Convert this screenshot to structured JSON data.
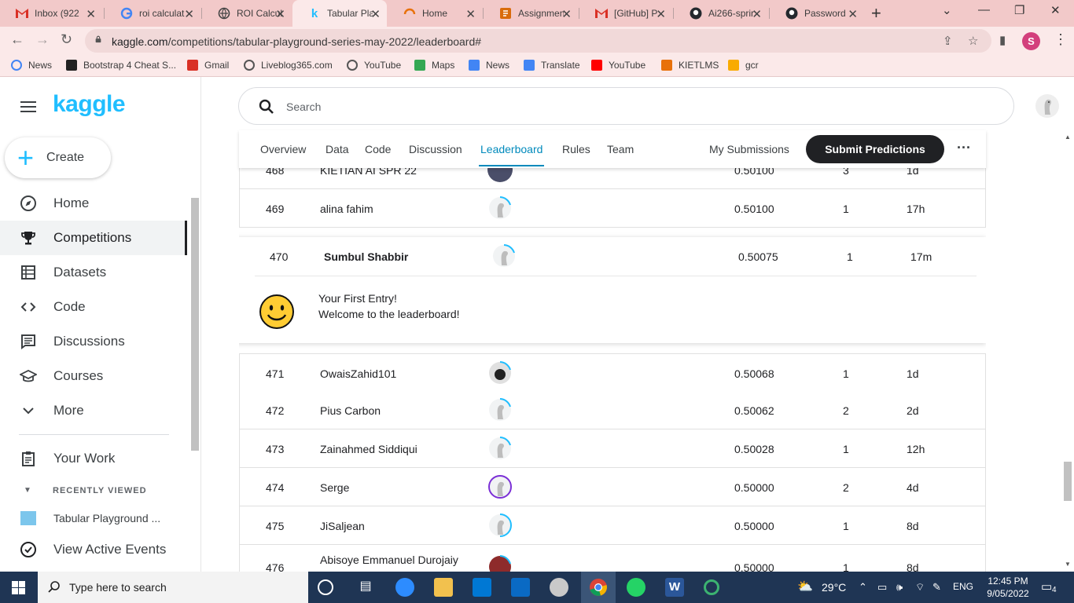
{
  "browser": {
    "tabs": [
      {
        "label": "Inbox (922",
        "icon": "gmail-icon"
      },
      {
        "label": "roi calculat",
        "icon": "google-icon"
      },
      {
        "label": "ROI Calcul",
        "icon": "globe-icon"
      },
      {
        "label": "Tabular Pla",
        "icon": "kaggle-icon",
        "active": true
      },
      {
        "label": "Home",
        "icon": "home-icon"
      },
      {
        "label": "Assignmen",
        "icon": "assignment-icon"
      },
      {
        "label": "[GitHub] P",
        "icon": "gmail-icon"
      },
      {
        "label": "Ai266-sprir",
        "icon": "github-icon"
      },
      {
        "label": "Password",
        "icon": "github-icon"
      }
    ],
    "url_host": "kaggle.com",
    "url_path": "/competitions/tabular-playground-series-may-2022/leaderboard#",
    "profile_initial": "S",
    "bookmarks": [
      "News",
      "Bootstrap 4 Cheat S...",
      "Gmail",
      "Liveblog365.com",
      "YouTube",
      "Maps",
      "News",
      "Translate",
      "YouTube",
      "KIETLMS",
      "gcr"
    ]
  },
  "sidebar": {
    "logo": "kaggle",
    "create_label": "Create",
    "items": [
      {
        "label": "Home",
        "icon": "compass-icon"
      },
      {
        "label": "Competitions",
        "icon": "trophy-icon",
        "active": true
      },
      {
        "label": "Datasets",
        "icon": "table-icon"
      },
      {
        "label": "Code",
        "icon": "code-icon"
      },
      {
        "label": "Discussions",
        "icon": "comments-icon"
      },
      {
        "label": "Courses",
        "icon": "graduation-cap-icon"
      },
      {
        "label": "More",
        "icon": "chevron-down-icon"
      }
    ],
    "your_work": "Your Work",
    "recently_viewed_header": "RECENTLY VIEWED",
    "recent_item": "Tabular Playground ...",
    "view_active_events": "View Active Events"
  },
  "search": {
    "placeholder": "Search"
  },
  "competition_tabs": {
    "items": [
      "Overview",
      "Data",
      "Code",
      "Discussion",
      "Leaderboard",
      "Rules",
      "Team"
    ],
    "active": "Leaderboard",
    "my_submissions": "My Submissions",
    "submit_label": "Submit Predictions"
  },
  "leaderboard": {
    "rows": [
      {
        "rank": "468",
        "team": "KIETIAN AI SPR 22",
        "score": "0.50100",
        "entries": "3",
        "last": "1d"
      },
      {
        "rank": "469",
        "team": "alina fahim",
        "score": "0.50100",
        "entries": "1",
        "last": "17h"
      },
      {
        "rank": "470",
        "team": "Sumbul Shabbir",
        "score": "0.50075",
        "entries": "1",
        "last": "17m",
        "highlight": true
      },
      {
        "rank": "471",
        "team": "OwaisZahid101",
        "score": "0.50068",
        "entries": "1",
        "last": "1d"
      },
      {
        "rank": "472",
        "team": "Pius Carbon",
        "score": "0.50062",
        "entries": "2",
        "last": "2d"
      },
      {
        "rank": "473",
        "team": "Zainahmed Siddiqui",
        "score": "0.50028",
        "entries": "1",
        "last": "12h"
      },
      {
        "rank": "474",
        "team": "Serge",
        "score": "0.50000",
        "entries": "2",
        "last": "4d"
      },
      {
        "rank": "475",
        "team": "JiSaljean",
        "score": "0.50000",
        "entries": "1",
        "last": "8d"
      },
      {
        "rank": "476",
        "team": "Abisoye Emmanuel Durojaiy",
        "score": "0.50000",
        "entries": "1",
        "last": "8d"
      }
    ],
    "first_entry_line1": "Your First Entry!",
    "first_entry_line2": "Welcome to the leaderboard!"
  },
  "taskbar": {
    "search_placeholder": "Type here to search",
    "weather": "29°C",
    "language": "ENG",
    "time": "12:45 PM",
    "date": "9/05/2022",
    "notifications": "4"
  },
  "colors": {
    "accent": "#20beff",
    "tab_active": "#008abc",
    "tabstrip": "#f2c9c9"
  }
}
